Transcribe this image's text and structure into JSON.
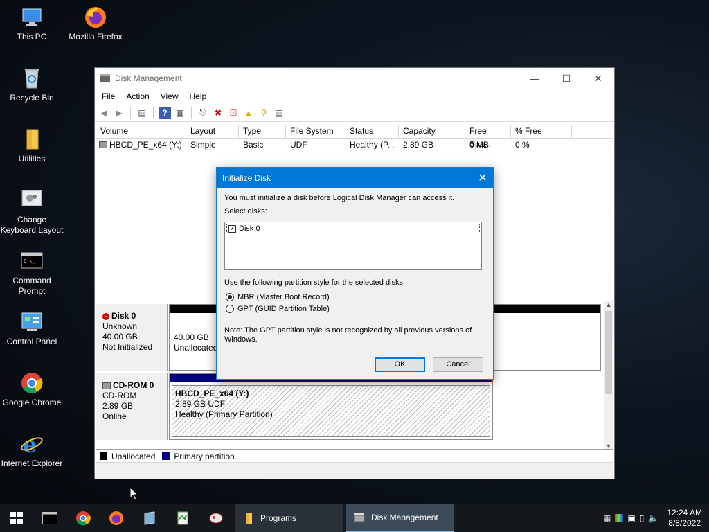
{
  "desktop": {
    "icons": [
      {
        "label": "This PC"
      },
      {
        "label": "Mozilla Firefox"
      },
      {
        "label": "Recycle Bin"
      },
      {
        "label": "Utilities"
      },
      {
        "label": "Change Keyboard Layout"
      },
      {
        "label": "Command Prompt"
      },
      {
        "label": "Control Panel"
      },
      {
        "label": "Google Chrome"
      },
      {
        "label": "Internet Explorer"
      }
    ]
  },
  "window": {
    "title": "Disk Management",
    "menu": [
      "File",
      "Action",
      "View",
      "Help"
    ],
    "columns": [
      "Volume",
      "Layout",
      "Type",
      "File System",
      "Status",
      "Capacity",
      "Free Spa...",
      "% Free"
    ],
    "volumes": [
      {
        "volume": "HBCD_PE_x64 (Y:)",
        "layout": "Simple",
        "type": "Basic",
        "fs": "UDF",
        "status": "Healthy (P...",
        "capacity": "2.89 GB",
        "free": "0 MB",
        "pct": "0 %"
      }
    ],
    "disks": [
      {
        "name": "Disk 0",
        "kind": "Unknown",
        "size": "40.00 GB",
        "state": "Not Initialized",
        "part_size": "40.00 GB",
        "part_label": "Unallocated"
      },
      {
        "name": "CD-ROM 0",
        "kind": "CD-ROM",
        "size": "2.89 GB",
        "state": "Online",
        "part_title": "HBCD_PE_x64  (Y:)",
        "part_fs": "2.89 GB UDF",
        "part_status": "Healthy (Primary Partition)"
      }
    ],
    "legend": {
      "unallocated": "Unallocated",
      "primary": "Primary partition"
    }
  },
  "dialog": {
    "title": "Initialize Disk",
    "intro": "You must initialize a disk before Logical Disk Manager can access it.",
    "select_label": "Select disks:",
    "disk_item": "Disk 0",
    "style_label": "Use the following partition style for the selected disks:",
    "mbr": "MBR (Master Boot Record)",
    "gpt": "GPT (GUID Partition Table)",
    "note": "Note: The GPT partition style is not recognized by all previous versions of Windows.",
    "ok": "OK",
    "cancel": "Cancel"
  },
  "taskbar": {
    "tasks": [
      "Programs",
      "Disk Management"
    ],
    "time": "12:24 AM",
    "date": "8/8/2022"
  },
  "colors": {
    "accent": "#0078d7",
    "primary_partition": "#000080",
    "unallocated": "#000000"
  }
}
